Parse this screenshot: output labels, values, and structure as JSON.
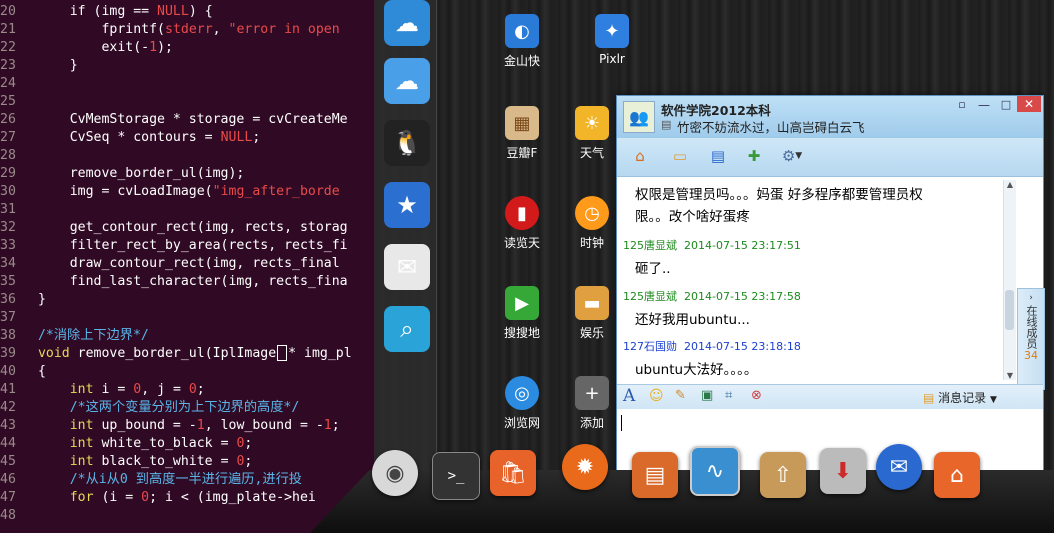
{
  "editor": {
    "lines": [
      {
        "num": "20",
        "indent": 1,
        "parts": [
          [
            "code",
            "if (img == "
          ],
          [
            "str",
            "NULL"
          ],
          [
            "code",
            ") {"
          ]
        ]
      },
      {
        "num": "21",
        "indent": 2,
        "parts": [
          [
            "code",
            "fprintf("
          ],
          [
            "str",
            "stderr"
          ],
          [
            "code",
            ", "
          ],
          [
            "str",
            "\"error in open"
          ]
        ]
      },
      {
        "num": "22",
        "indent": 2,
        "parts": [
          [
            "code",
            "exit(-"
          ],
          [
            "str",
            "1"
          ],
          [
            "code",
            ");"
          ]
        ]
      },
      {
        "num": "23",
        "indent": 1,
        "parts": [
          [
            "code",
            "}"
          ]
        ]
      },
      {
        "num": "24",
        "indent": 0,
        "parts": []
      },
      {
        "num": "25",
        "indent": 0,
        "parts": []
      },
      {
        "num": "26",
        "indent": 1,
        "parts": [
          [
            "code",
            "CvMemStorage * storage = cvCreateMe"
          ]
        ]
      },
      {
        "num": "27",
        "indent": 1,
        "parts": [
          [
            "code",
            "CvSeq * contours = "
          ],
          [
            "str",
            "NULL"
          ],
          [
            "code",
            ";"
          ]
        ]
      },
      {
        "num": "28",
        "indent": 0,
        "parts": []
      },
      {
        "num": "29",
        "indent": 1,
        "parts": [
          [
            "code",
            "remove_border_ul(img);"
          ]
        ]
      },
      {
        "num": "30",
        "indent": 1,
        "parts": [
          [
            "code",
            "img = cvLoadImage("
          ],
          [
            "str",
            "\"img_after_borde"
          ]
        ]
      },
      {
        "num": "31",
        "indent": 0,
        "parts": []
      },
      {
        "num": "32",
        "indent": 1,
        "parts": [
          [
            "code",
            "get_contour_rect(img, rects, storag"
          ]
        ]
      },
      {
        "num": "33",
        "indent": 1,
        "parts": [
          [
            "code",
            "filter_rect_by_area(rects, rects_fi"
          ]
        ]
      },
      {
        "num": "34",
        "indent": 1,
        "parts": [
          [
            "code",
            "draw_contour_rect(img, rects_final"
          ]
        ]
      },
      {
        "num": "35",
        "indent": 1,
        "parts": [
          [
            "code",
            "find_last_character(img, rects_fina"
          ]
        ]
      },
      {
        "num": "36",
        "indent": 0,
        "parts": [
          [
            "code",
            "}"
          ]
        ]
      },
      {
        "num": "37",
        "indent": 0,
        "parts": []
      },
      {
        "num": "38",
        "indent": 0,
        "parts": [
          [
            "cm",
            "/*消除上下边界*/"
          ]
        ]
      },
      {
        "num": "39",
        "indent": 0,
        "parts": [
          [
            "kw",
            "void"
          ],
          [
            "code",
            " remove_border_ul(IplImage"
          ],
          [
            "cursor",
            ""
          ],
          [
            "code",
            "* img_pl"
          ]
        ]
      },
      {
        "num": "40",
        "indent": 0,
        "parts": [
          [
            "code",
            "{"
          ]
        ]
      },
      {
        "num": "41",
        "indent": 1,
        "parts": [
          [
            "kw",
            "int"
          ],
          [
            "code",
            " i = "
          ],
          [
            "str",
            "0"
          ],
          [
            "code",
            ", j = "
          ],
          [
            "str",
            "0"
          ],
          [
            "code",
            ";"
          ]
        ]
      },
      {
        "num": "42",
        "indent": 1,
        "parts": [
          [
            "cm",
            "/*这两个变量分别为上下边界的高度*/"
          ]
        ]
      },
      {
        "num": "43",
        "indent": 1,
        "parts": [
          [
            "kw",
            "int"
          ],
          [
            "code",
            " up_bound = -"
          ],
          [
            "str",
            "1"
          ],
          [
            "code",
            ", low_bound = -"
          ],
          [
            "str",
            "1"
          ],
          [
            "code",
            ";"
          ]
        ]
      },
      {
        "num": "44",
        "indent": 1,
        "parts": [
          [
            "kw",
            "int"
          ],
          [
            "code",
            " white_to_black = "
          ],
          [
            "str",
            "0"
          ],
          [
            "code",
            ";"
          ]
        ]
      },
      {
        "num": "45",
        "indent": 1,
        "parts": [
          [
            "kw",
            "int"
          ],
          [
            "code",
            " black_to_white = "
          ],
          [
            "str",
            "0"
          ],
          [
            "code",
            ";"
          ]
        ]
      },
      {
        "num": "46",
        "indent": 1,
        "parts": [
          [
            "cm",
            "/*从i从0 到高度一半进行遍历,进行投"
          ]
        ]
      },
      {
        "num": "47",
        "indent": 1,
        "parts": [
          [
            "kw",
            "for"
          ],
          [
            "code",
            " (i = "
          ],
          [
            "str",
            "0"
          ],
          [
            "code",
            "; i < (img_plate->hei"
          ]
        ]
      },
      {
        "num": "48",
        "indent": 0,
        "parts": []
      }
    ]
  },
  "desktop": {
    "icons": [
      {
        "label": "金山快",
        "icon": "kingsoft-icon",
        "color": "#2a7bd8"
      },
      {
        "label": "Pixlr",
        "icon": "pixlr-icon",
        "color": "#2f7fe0"
      },
      {
        "label": "豆瓣F",
        "icon": "douban-icon",
        "color": "#d9b88a"
      },
      {
        "label": "天气",
        "icon": "weather-icon",
        "color": "#f2b52a"
      },
      {
        "label": "读览天",
        "icon": "reader-icon",
        "color": "#d31a1a"
      },
      {
        "label": "时钟",
        "icon": "clock-icon",
        "color": "#ff9a1a"
      },
      {
        "label": "搜搜地",
        "icon": "map-icon",
        "color": "#35a838"
      },
      {
        "label": "娱乐",
        "icon": "folder-icon",
        "color": "#e0a040"
      },
      {
        "label": "浏览网",
        "icon": "browser-icon",
        "color": "#2a8be0"
      },
      {
        "label": "添加",
        "icon": "add-icon",
        "color": "#666666"
      }
    ]
  },
  "launcher": {
    "items": [
      {
        "icon": "shopping-bag-icon",
        "color": "#2f8ad8",
        "glyph": "☁"
      },
      {
        "icon": "cloud-drive-icon",
        "color": "#4aa0e8",
        "glyph": "☁"
      },
      {
        "icon": "qq-penguin-icon",
        "color": "#222222",
        "glyph": "🐧"
      },
      {
        "icon": "qzone-icon",
        "color": "#2b6fd0",
        "glyph": "★"
      },
      {
        "icon": "mail-icon",
        "color": "#e8e8e8",
        "glyph": "✉"
      },
      {
        "icon": "search-location-icon",
        "color": "#29a3d8",
        "glyph": "⌕"
      }
    ]
  },
  "chat": {
    "contact_name": "软件学院2012本科",
    "status_text": "竹密不妨流水过，山高岂碍白云飞",
    "messages": [
      {
        "sender": "",
        "time": "",
        "text": "权限是管理员吗。。。妈蛋 好多程序都要管理员权",
        "text2": "限。。改个啥好蛋疼",
        "color": "#000000"
      },
      {
        "sender": "125唐显斌",
        "time": "2014-07-15 23:17:51",
        "text": "砸了..",
        "color": "#1c8a1c"
      },
      {
        "sender": "125唐显斌",
        "time": "2014-07-15 23:17:58",
        "text": "还好我用ubuntu...",
        "color": "#1c8a1c"
      },
      {
        "sender": "127石国勋",
        "time": "2014-07-15 23:18:18",
        "text": "ubuntu大法好。。。。",
        "color": "#1a3fd0"
      }
    ],
    "side_label": "在线成员",
    "online_count": "34",
    "history_label": "消息记录",
    "font_button": "A"
  },
  "dock": {
    "items": [
      {
        "icon": "ubuntu-icon",
        "color": "#dddddd"
      },
      {
        "icon": "terminal-icon",
        "color": "#333333"
      },
      {
        "icon": "software-center-icon",
        "color": "#e8632a"
      },
      {
        "icon": "firefox-icon",
        "color": "#e86a1a"
      },
      {
        "icon": "files-icon",
        "color": "#d96a2a"
      },
      {
        "icon": "system-monitor-icon",
        "color": "#3a8fd0"
      },
      {
        "icon": "box-upload-icon",
        "color": "#c89a5a"
      },
      {
        "icon": "installer-icon",
        "color": "#cc2a2a"
      },
      {
        "icon": "thunderbird-icon",
        "color": "#2a6ad0"
      },
      {
        "icon": "home-folder-icon",
        "color": "#e8662a"
      }
    ]
  }
}
